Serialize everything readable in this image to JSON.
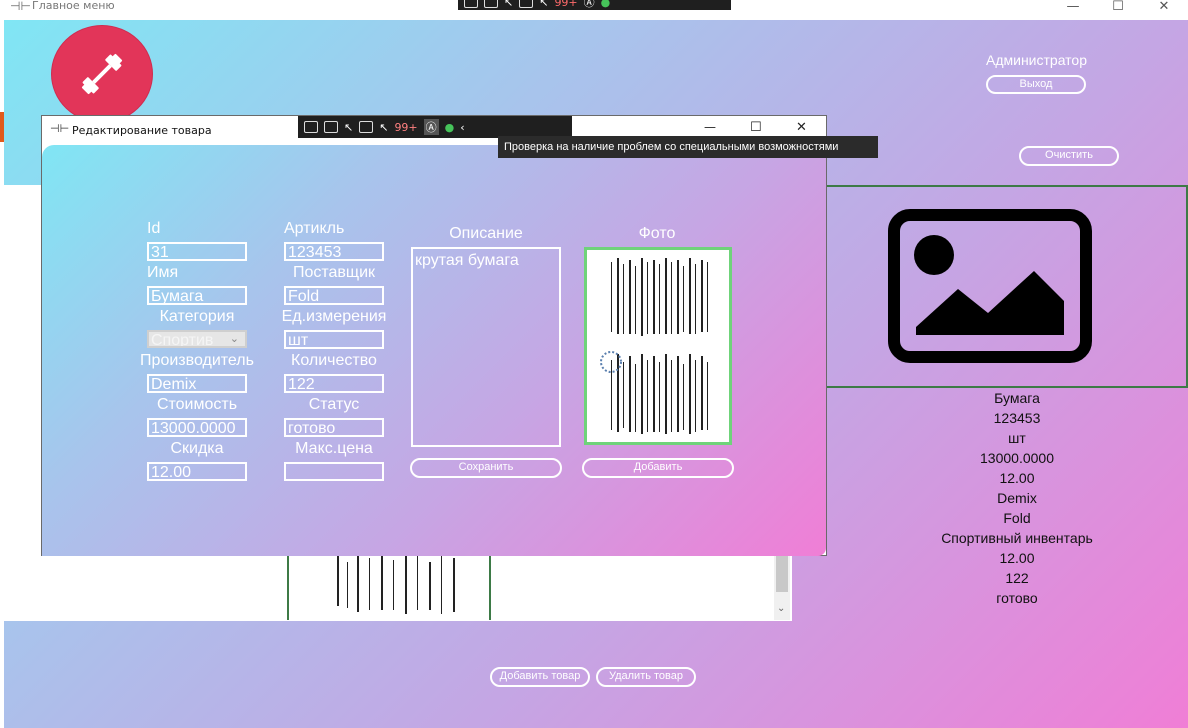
{
  "main_window": {
    "title": "Главное меню",
    "controls": {
      "minimize": "—",
      "maximize": "☐",
      "close": "✕"
    }
  },
  "header": {
    "user_role": "Администратор",
    "logout_button": "Выход",
    "clear_button": "Очистить"
  },
  "product_details": [
    "Бумага",
    "123453",
    "шт",
    "13000.0000",
    "12.00",
    "Demix",
    "Fold",
    "Спортивный инвентарь",
    "12.00",
    "122",
    "готово"
  ],
  "footer": {
    "add_product_button": "Добавить товар",
    "delete_product_button": "Удалить товар"
  },
  "dev_toolbar": {
    "badge": "99+"
  },
  "tooltip": "Проверка на наличие проблем со специальными возможностями",
  "dialog": {
    "title": "Редактирование товара",
    "controls": {
      "minimize": "—",
      "maximize": "☐",
      "close": "✕"
    },
    "fields": {
      "id": {
        "label": "Id",
        "value": "31"
      },
      "name": {
        "label": "Имя",
        "value": "Бумага"
      },
      "category": {
        "label": "Категория",
        "value": "Спортив"
      },
      "manufacturer": {
        "label": "Производитель",
        "value": "Demix"
      },
      "cost": {
        "label": "Стоимость",
        "value": "13000.0000"
      },
      "discount": {
        "label": "Скидка",
        "value": "12.00"
      },
      "article": {
        "label": "Артикль",
        "value": "123453"
      },
      "supplier": {
        "label": "Поставщик",
        "value": "Fold"
      },
      "unit": {
        "label": "Ед.измерения",
        "value": "шт"
      },
      "quantity": {
        "label": "Количество",
        "value": "122"
      },
      "status": {
        "label": "Статус",
        "value": "готово"
      },
      "max_price": {
        "label": "Макс.цена",
        "value": ""
      }
    },
    "description": {
      "label": "Описание",
      "value": "крутая бумага"
    },
    "photo": {
      "label": "Фото"
    },
    "save_button": "Сохранить",
    "add_button": "Добавить"
  },
  "colors": {
    "gradient_start": "#80e6f4",
    "gradient_end": "#f07ed6",
    "logo_red": "#e23559",
    "card_border": "#3d7a46"
  }
}
